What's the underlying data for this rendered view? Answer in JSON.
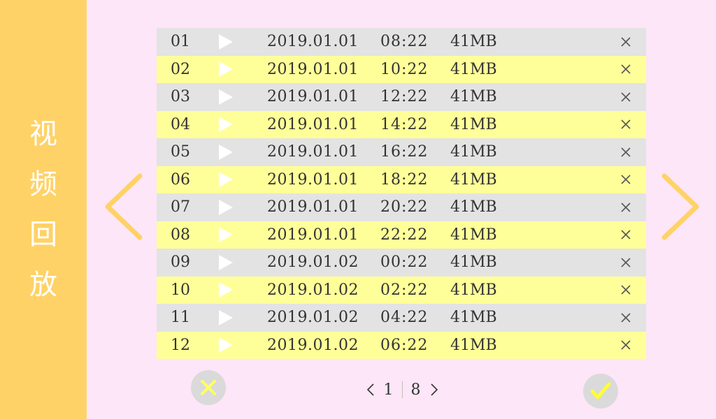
{
  "sidebar": {
    "title_chars": [
      "视",
      "频",
      "回",
      "放"
    ]
  },
  "icons": {
    "left_arrow": "chevron-left-icon",
    "right_arrow": "chevron-right-icon",
    "play": "play-icon",
    "delete": "close-icon",
    "cancel": "close-icon",
    "confirm": "check-icon"
  },
  "colors": {
    "background": "#fde6f7",
    "sidebar": "#ffd267",
    "row_gray": "#e3e3e3",
    "row_yellow": "#ffff99",
    "accent_yellow": "#ffe066"
  },
  "recordings": [
    {
      "index": "01",
      "date": "2019.01.01",
      "time": "08:22",
      "size": "41MB"
    },
    {
      "index": "02",
      "date": "2019.01.01",
      "time": "10:22",
      "size": "41MB"
    },
    {
      "index": "03",
      "date": "2019.01.01",
      "time": "12:22",
      "size": "41MB"
    },
    {
      "index": "04",
      "date": "2019.01.01",
      "time": "14:22",
      "size": "41MB"
    },
    {
      "index": "05",
      "date": "2019.01.01",
      "time": "16:22",
      "size": "41MB"
    },
    {
      "index": "06",
      "date": "2019.01.01",
      "time": "18:22",
      "size": "41MB"
    },
    {
      "index": "07",
      "date": "2019.01.01",
      "time": "20:22",
      "size": "41MB"
    },
    {
      "index": "08",
      "date": "2019.01.01",
      "time": "22:22",
      "size": "41MB"
    },
    {
      "index": "09",
      "date": "2019.01.02",
      "time": "00:22",
      "size": "41MB"
    },
    {
      "index": "10",
      "date": "2019.01.02",
      "time": "02:22",
      "size": "41MB"
    },
    {
      "index": "11",
      "date": "2019.01.02",
      "time": "04:22",
      "size": "41MB"
    },
    {
      "index": "12",
      "date": "2019.01.02",
      "time": "06:22",
      "size": "41MB"
    }
  ],
  "pagination": {
    "current": "1",
    "total": "8"
  }
}
